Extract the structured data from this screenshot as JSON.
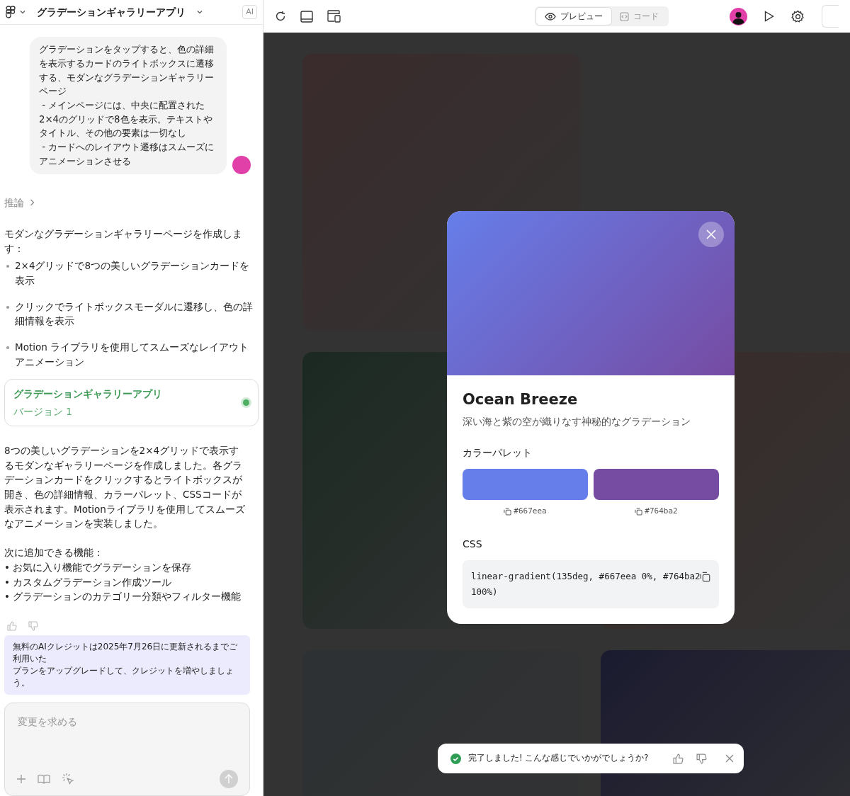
{
  "header": {
    "title": "グラデーションギャラリーアプリ",
    "badge": "AI"
  },
  "toolbar": {
    "tabs": [
      {
        "label": "プレビュー",
        "selected": true,
        "kind": "preview"
      },
      {
        "label": "コード",
        "selected": false,
        "kind": "code"
      }
    ]
  },
  "chat": {
    "user_message": "グラデーションをタップすると、色の詳細を表示するカードのライトボックスに遷移する、モダンなグラデーションギャラリーページ\n - メインページには、中央に配置された2×4のグリッドで8色を表示。テキストやタイトル、その他の要素は一切なし\n - カードへのレイアウト遷移はスムーズにアニメーションさせる",
    "reasoning_label": "推論",
    "intro": "モダンなグラデーションギャラリーページを作成します：",
    "bullets": [
      "2×4グリッドで8つの美しいグラデーションカードを表示",
      "クリックでライトボックスモーダルに遷移し、色の詳細情報を表示",
      "Motion ライブラリを使用してスムーズなレイアウトアニメーション"
    ],
    "version_card": {
      "title": "グラデーションギャラリーアプリ",
      "subtitle": "バージョン 1",
      "color": "#4caf62"
    },
    "summary": "8つの美しいグラデーションを2×4グリッドで表示するモダンなギャラリーページを作成しました。各グラデーションカードをクリックするとライトボックスが開き、色の詳細情報、カラーパレット、CSSコードが表示されます。Motionライブラリを使用してスムーズなアニメーションを実装しました。",
    "next_heading": "次に追加できる機能：",
    "next_items": [
      "• お気に入り機能でグラデーションを保存",
      "• カスタムグラデーション作成ツール",
      "• グラデーションのカテゴリー分類やフィルター機能"
    ]
  },
  "credit_notice": [
    "無料のAIクレジットは2025年7月26日に更新されるまでご利用いた",
    "プランをアップグレードして、クレジットを増やしましょう。"
  ],
  "composer": {
    "placeholder": "変更を求める"
  },
  "gallery_cards": [
    {
      "color": "#3a2b2c"
    },
    {
      "color": "#1b2922"
    },
    {
      "color": "#392b29"
    },
    {
      "color": "#2d3133"
    },
    {
      "color": "#1b1b30"
    }
  ],
  "modal": {
    "title": "Ocean Breeze",
    "description": "深い海と紫の空が織りなす神秘的なグラデーション",
    "palette_heading": "カラーパレット",
    "swatches": [
      {
        "color": "#667eea",
        "label": "#667eea"
      },
      {
        "color": "#764ba2",
        "label": "#764ba2"
      }
    ],
    "css_heading": "CSS",
    "css_code": "linear-gradient(135deg, #667eea 0%, #764ba2 100%)"
  },
  "toast": {
    "message": "完了しました! こんな感じでいかがでしょうか?"
  }
}
